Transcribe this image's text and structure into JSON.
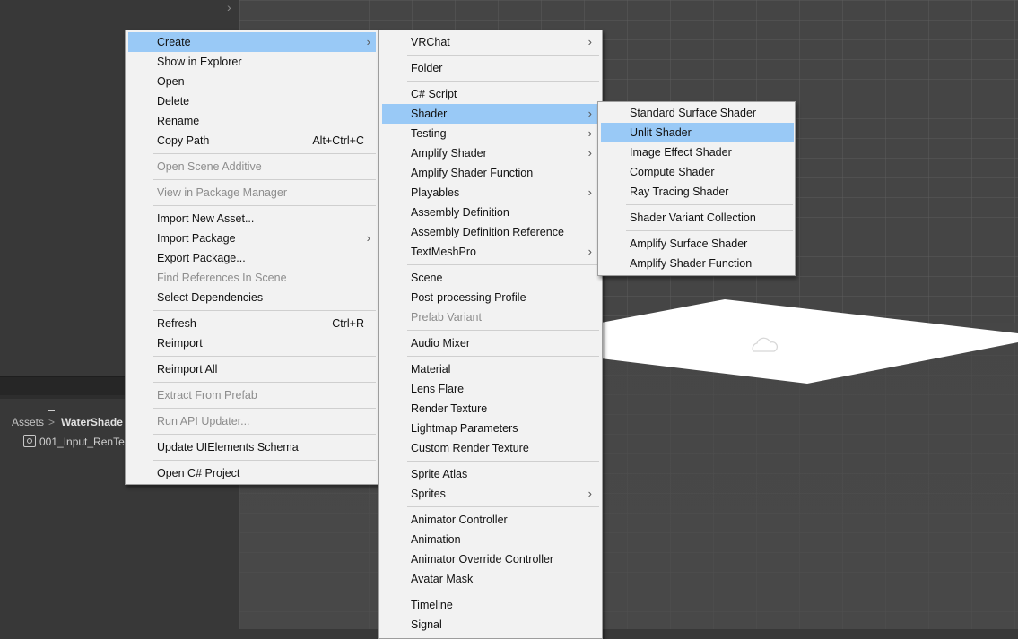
{
  "project_panel": {
    "breadcrumb": [
      "Assets",
      "WaterShade"
    ],
    "breadcrumb_separator": ">",
    "asset_row_label": "001_Input_RenTe"
  },
  "main_menu": {
    "items": [
      {
        "label": "Create",
        "submenu": true,
        "highlighted": true
      },
      {
        "label": "Show in Explorer"
      },
      {
        "label": "Open"
      },
      {
        "label": "Delete"
      },
      {
        "label": "Rename"
      },
      {
        "label": "Copy Path",
        "shortcut": "Alt+Ctrl+C"
      },
      {
        "label": "Open Scene Additive",
        "disabled": true
      },
      {
        "label": "View in Package Manager",
        "disabled": true
      },
      {
        "label": "Import New Asset..."
      },
      {
        "label": "Import Package",
        "submenu": true
      },
      {
        "label": "Export Package..."
      },
      {
        "label": "Find References In Scene",
        "disabled": true
      },
      {
        "label": "Select Dependencies"
      },
      {
        "label": "Refresh",
        "shortcut": "Ctrl+R"
      },
      {
        "label": "Reimport"
      },
      {
        "label": "Reimport All"
      },
      {
        "label": "Extract From Prefab",
        "disabled": true
      },
      {
        "label": "Run API Updater...",
        "disabled": true
      },
      {
        "label": "Update UIElements Schema"
      },
      {
        "label": "Open C# Project"
      }
    ]
  },
  "create_menu": {
    "items": [
      {
        "label": "VRChat",
        "submenu": true
      },
      {
        "label": "Folder"
      },
      {
        "label": "C# Script"
      },
      {
        "label": "Shader",
        "submenu": true,
        "highlighted": true
      },
      {
        "label": "Testing",
        "submenu": true
      },
      {
        "label": "Amplify Shader",
        "submenu": true
      },
      {
        "label": "Amplify Shader Function"
      },
      {
        "label": "Playables",
        "submenu": true
      },
      {
        "label": "Assembly Definition"
      },
      {
        "label": "Assembly Definition Reference"
      },
      {
        "label": "TextMeshPro",
        "submenu": true
      },
      {
        "label": "Scene"
      },
      {
        "label": "Post-processing Profile"
      },
      {
        "label": "Prefab Variant",
        "disabled": true
      },
      {
        "label": "Audio Mixer"
      },
      {
        "label": "Material"
      },
      {
        "label": "Lens Flare"
      },
      {
        "label": "Render Texture"
      },
      {
        "label": "Lightmap Parameters"
      },
      {
        "label": "Custom Render Texture"
      },
      {
        "label": "Sprite Atlas"
      },
      {
        "label": "Sprites",
        "submenu": true
      },
      {
        "label": "Animator Controller"
      },
      {
        "label": "Animation"
      },
      {
        "label": "Animator Override Controller"
      },
      {
        "label": "Avatar Mask"
      },
      {
        "label": "Timeline"
      },
      {
        "label": "Signal"
      }
    ]
  },
  "shader_menu": {
    "items": [
      {
        "label": "Standard Surface Shader"
      },
      {
        "label": "Unlit Shader",
        "highlighted": true
      },
      {
        "label": "Image Effect Shader"
      },
      {
        "label": "Compute Shader"
      },
      {
        "label": "Ray Tracing Shader"
      },
      {
        "label": "Shader Variant Collection"
      },
      {
        "label": "Amplify Surface Shader"
      },
      {
        "label": "Amplify Shader Function"
      }
    ]
  },
  "colors": {
    "menu_bg": "#f2f2f2",
    "highlight": "#99c9f6",
    "disabled_text": "#8d8d8d",
    "editor_bg": "#383838"
  },
  "icons": {
    "submenu_arrow": "chevron-right-icon",
    "panel_collapse": "chevron-right-icon",
    "asset": "render-texture-icon",
    "scene_gizmo": "cloud-gizmo-icon"
  }
}
